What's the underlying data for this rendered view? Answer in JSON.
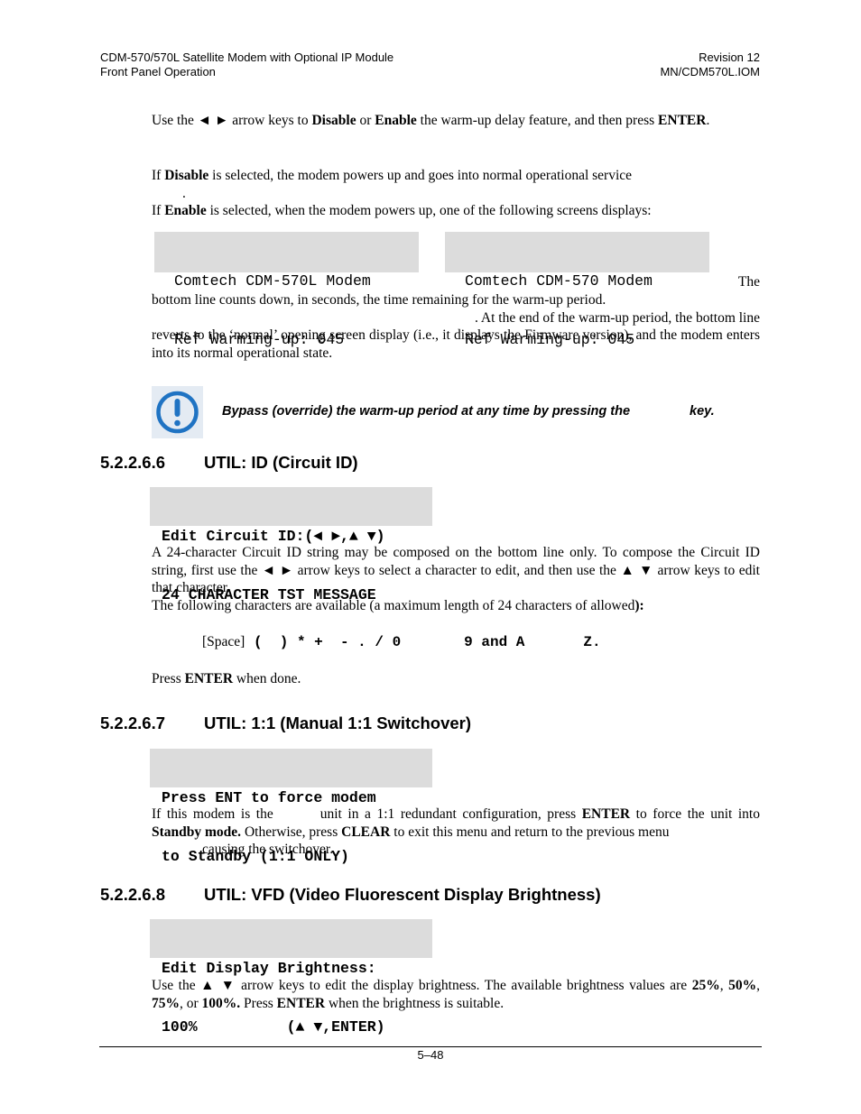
{
  "header": {
    "title": "CDM-570/570L Satellite Modem with Optional IP Module",
    "subtitle": "Front Panel Operation",
    "revision": "Revision 12",
    "doc_number": "MN/CDM570L.IOM"
  },
  "intro": {
    "p1": {
      "a": "Use the ",
      "arrows": "◄  ►",
      "b": "  arrow keys to ",
      "disable": "Disable",
      "c": " or ",
      "enable": "Enable",
      "d": " the warm-up delay feature, and then press ",
      "enter": "ENTER",
      "e": "."
    },
    "p2": {
      "a": "If ",
      "disable": "Disable",
      "b": " is selected, the modem powers up and goes into normal operational service",
      "c": "."
    },
    "p3": {
      "a": "If ",
      "enable": "Enable",
      "b": " is selected, when the modem powers up, one of the following screens displays:"
    },
    "lcd_left": {
      "line1": "Comtech CDM-570L Modem",
      "line2": "Ref Warming-up: 045"
    },
    "lcd_right": {
      "line1": "Comtech CDM-570 Modem",
      "line2": "Ref Warming-up: 045"
    },
    "p4": {
      "the": "The",
      "line1": "bottom line counts down, in seconds, the time remaining for the warm-up period.",
      "line2": ". At the end of the warm-up period, the bottom line",
      "rest": "reverts to the ‘normal’ opening screen display (i.e., it displays the Firmware version), and the modem enters into its normal operational state."
    },
    "note": {
      "icon": "exclamation-circle-icon",
      "text_a": "Bypass (override) the warm-up period at any time by pressing the",
      "text_b": "key."
    }
  },
  "sections": {
    "circuit_id": {
      "number": "5.2.2.6.6",
      "title": "UTIL: ID (Circuit ID)",
      "lcd": {
        "line1": "Edit Circuit ID:(◄ ►,▲ ▼)",
        "line2": "24 CHARACTER TST MESSAGE"
      },
      "p1": "A 24-character Circuit ID string may be composed on the bottom line only. To compose the Circuit ID string, first use the ◄ ► arrow keys to select a character to edit, and then use the ▲ ▼ arrow keys to edit that character.",
      "p2_a": "The following characters are available (a maximum length of 24 characters of allowed",
      "p2_b": "):",
      "chars_space": "[Space]",
      "chars_a": " (  ) * +  - . / 0",
      "chars_b": "9 and A",
      "chars_c": "Z.",
      "press_a": "Press ",
      "press_enter": "ENTER",
      "press_b": " when done."
    },
    "switchover": {
      "number": "5.2.2.6.7",
      "title": "UTIL: 1:1 (Manual 1:1 Switchover)",
      "lcd": {
        "line1": "Press ENT to force modem",
        "line2": "to Standby (1:1 ONLY)"
      },
      "p_a": "If this modem is the",
      "p_b": "unit in a 1:1 redundant configuration, press ",
      "p_enter": "ENTER",
      "p_c": " to force the unit into ",
      "p_standby": "Standby mode.",
      "p_d": " Otherwise, press ",
      "p_clear": "CLEAR",
      "p_e": " to exit this menu and return to the previous menu",
      "p_f": "causing the switchover."
    },
    "vfd": {
      "number": "5.2.2.6.8",
      "title": "UTIL: VFD (Video Fluorescent Display Brightness)",
      "lcd": {
        "line1": "Edit Display Brightness:",
        "line2": "100%          (▲ ▼,ENTER)"
      },
      "p_a": "Use the ▲ ▼ arrow keys to edit the display brightness. The available brightness values are ",
      "v25": "25%",
      "sep1": ", ",
      "v50": "50%",
      "sep2": ", ",
      "v75": "75%",
      "sep3": ", or ",
      "v100": "100%.",
      "p_b": " Press ",
      "p_enter": "ENTER",
      "p_c": " when the brightness is suitable."
    }
  },
  "footer": {
    "page": "5–48"
  }
}
